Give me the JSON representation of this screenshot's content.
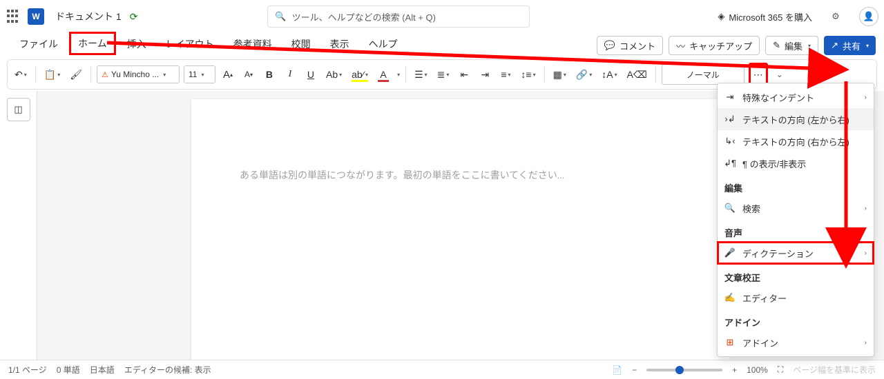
{
  "titlebar": {
    "app_initial": "W",
    "doc_title": "ドキュメント 1",
    "search_placeholder": "ツール、ヘルプなどの検索 (Alt + Q)",
    "buy_label": "Microsoft 365 を購入"
  },
  "tabs": {
    "file": "ファイル",
    "home": "ホーム",
    "insert": "挿入",
    "layout": "レイアウト",
    "references": "参考資料",
    "review": "校閲",
    "view": "表示",
    "help": "ヘルプ"
  },
  "actions": {
    "comment": "コメント",
    "catchup": "キャッチアップ",
    "editing": "編集",
    "share": "共有"
  },
  "ribbon": {
    "font_name": "Yu Mincho ...",
    "font_size": "11",
    "increase_font": "A",
    "decrease_font": "A",
    "bold": "B",
    "italic": "I",
    "underline": "U",
    "text_effects": "Ab",
    "highlight": "ab⁄",
    "font_color": "A",
    "style_normal": "ノーマル"
  },
  "overflow": {
    "special_indent": "特殊なインデント",
    "text_dir_ltr": "テキストの方向 (左から右)",
    "text_dir_rtl": "テキストの方向 (右から左)",
    "para_marks": "¶ の表示/非表示",
    "edit_header": "編集",
    "find": "検索",
    "voice_header": "音声",
    "dictate": "ディクテーション",
    "proofing_header": "文章校正",
    "editor": "エディター",
    "addin_header": "アドイン",
    "addin": "アドイン"
  },
  "document": {
    "placeholder": "ある単語は別の単語につながります。最初の単語をここに書いてください..."
  },
  "statusbar": {
    "page": "1/1 ページ",
    "words": "0 単語",
    "lang": "日本語",
    "editor_status": "エディターの候補: 表示",
    "zoom": "100%",
    "fit": "ページ幅を基準に表示"
  }
}
